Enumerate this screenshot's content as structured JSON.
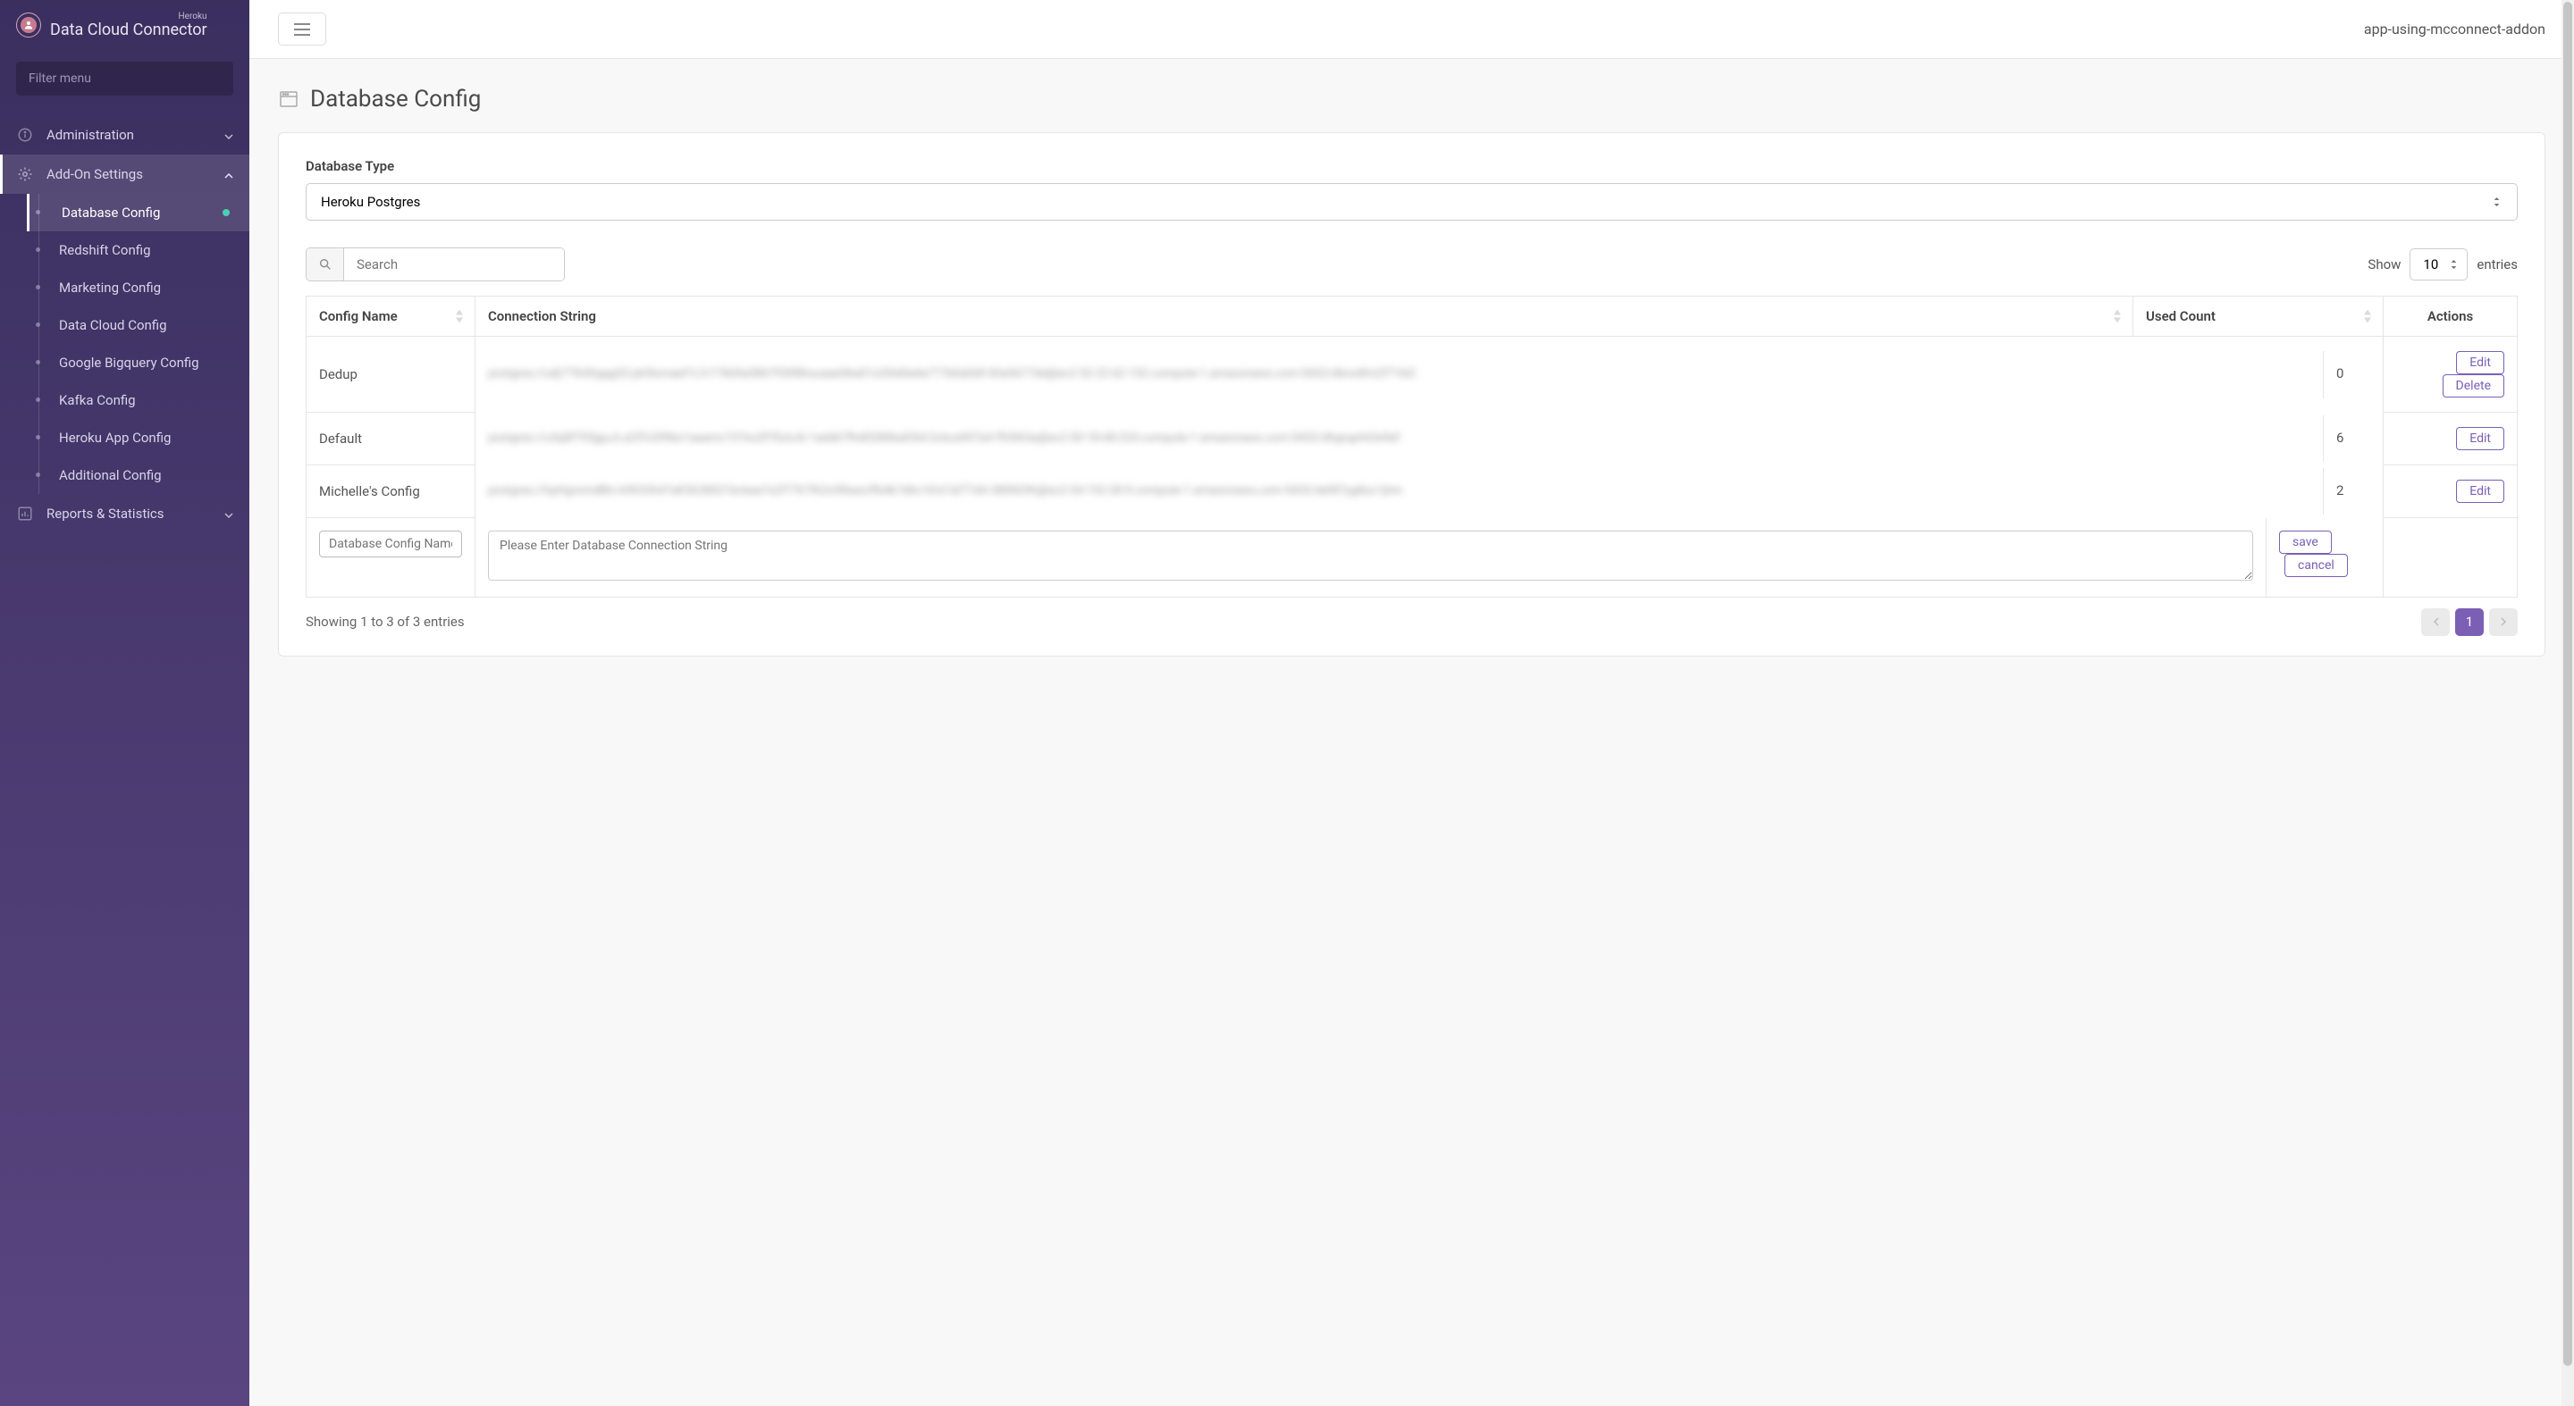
{
  "brand": {
    "supertitle": "Heroku",
    "title": "Data Cloud Connector"
  },
  "sidebar": {
    "filter_placeholder": "Filter menu",
    "items": {
      "administration": "Administration",
      "addon_settings": "Add-On Settings",
      "reports": "Reports & Statistics"
    },
    "sub_items": [
      {
        "label": "Database Config",
        "active": true,
        "dot": true
      },
      {
        "label": "Redshift Config"
      },
      {
        "label": "Marketing Config"
      },
      {
        "label": "Data Cloud Config"
      },
      {
        "label": "Google Bigquery Config"
      },
      {
        "label": "Kafka Config"
      },
      {
        "label": "Heroku App Config"
      },
      {
        "label": "Additional Config"
      }
    ]
  },
  "topbar": {
    "app_name": "app-using-mcconnect-addon"
  },
  "page": {
    "title": "Database Config",
    "db_type_label": "Database Type",
    "db_type_value": "Heroku Postgres",
    "search_placeholder": "Search",
    "show_label": "Show",
    "entries_label": "entries",
    "entries_value": "10"
  },
  "table": {
    "headers": {
      "config_name": "Config Name",
      "connection_string": "Connection String",
      "used_count": "Used Count",
      "actions": "Actions"
    },
    "rows": [
      {
        "name": "Dedup",
        "conn": "postgres://u4j779r0hgqg52:pk5lomaef1Lfv778d5a58lt7f39f8huuaaeSka01x20Id0a4a777b0a0d9 83a5677dd@ec2-52-22-62-152.compute-1.amazonaws.com:5432/dbrodfm2f71bl2",
        "count": "0",
        "actions": [
          "Edit",
          "Delete"
        ]
      },
      {
        "name": "Default",
        "conn": "postgres://u3q8f793jguJt.a25%209bx1aaamc151hu2Ff5ckJ6-1add67fhd0280ba03i4:2cbca901b4 ffU063a@ec2-50-18-68-224.compute-1.amazonaws.com:5432/dhgngnhl2e9ef",
        "count": "6",
        "actions": [
          "Edit"
        ]
      },
      {
        "name": "Michelle's Config",
        "conn": "postgres://hpHgromdBtc-k9033h47aK5628021bckaa7u2f77k7f62c0fbaxcffb4k7d6c18:b7af77d4 380N29h@ec2-54-152-28-9.compute-1.amazonaws.com:5432/def87yg8oc1jhm",
        "count": "2",
        "actions": [
          "Edit"
        ]
      }
    ],
    "new_row": {
      "name_placeholder": "Database Config Name",
      "conn_placeholder": "Please Enter Database Connection String",
      "save": "save",
      "cancel": "cancel"
    },
    "footer_info": "Showing 1 to 3 of 3 entries",
    "current_page": "1"
  }
}
